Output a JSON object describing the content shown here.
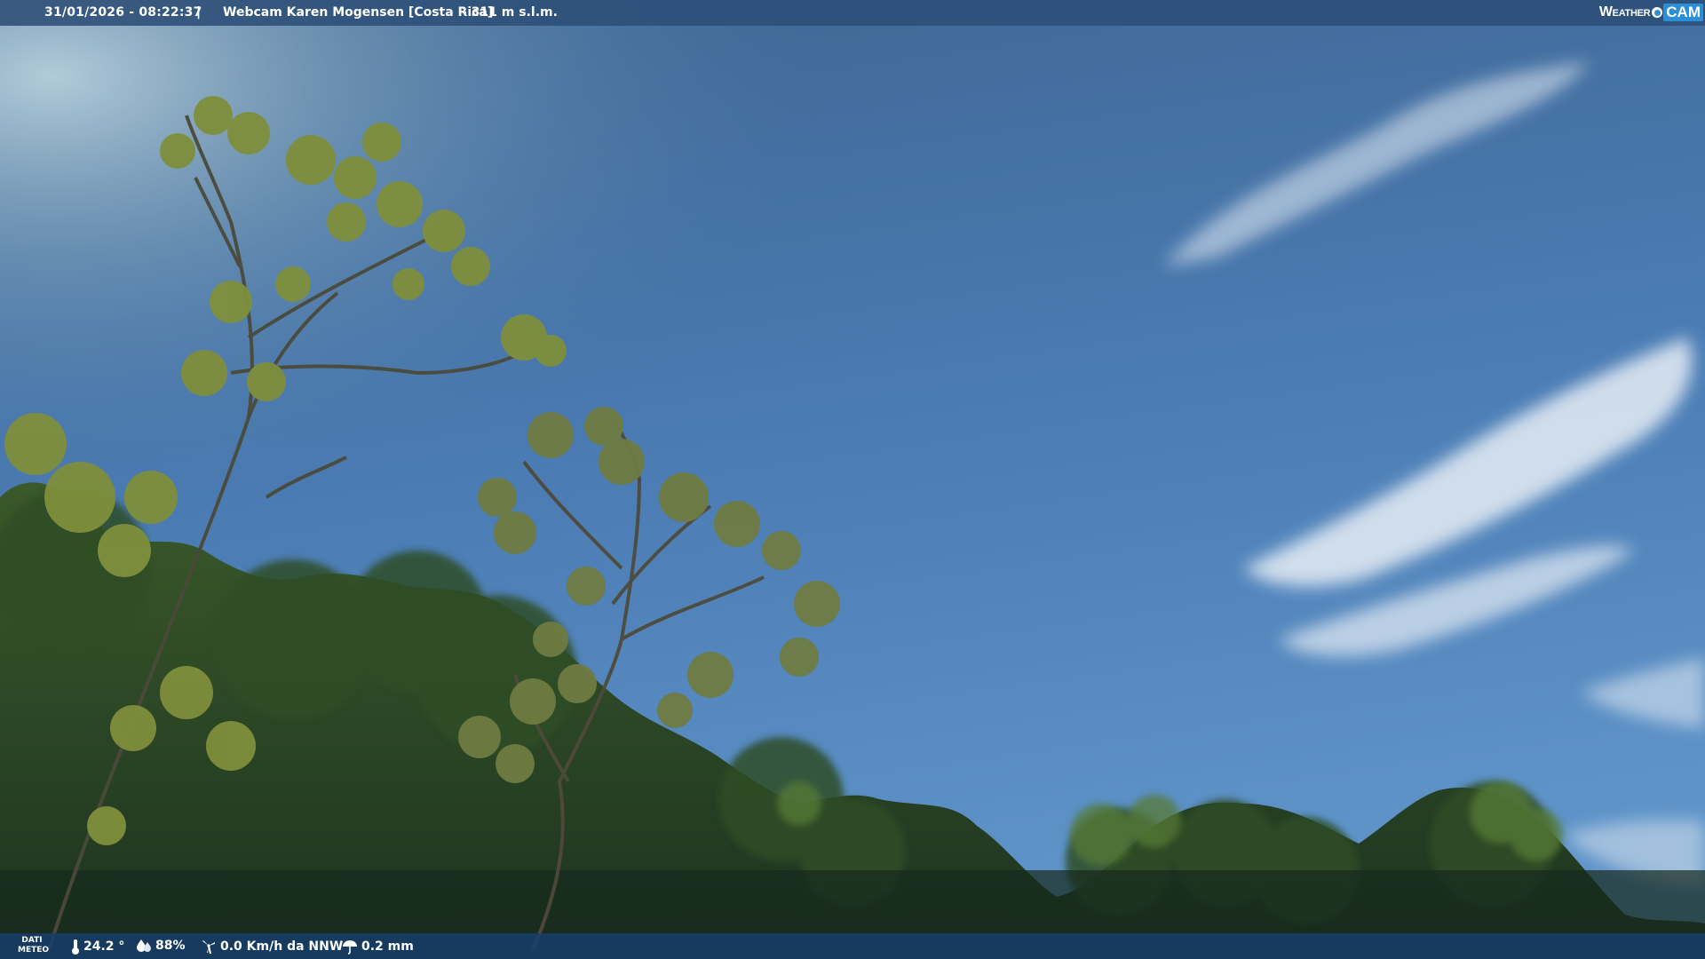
{
  "header": {
    "timestamp": "31/01/2026 - 08:22:37",
    "separator": "|",
    "camera_title": "Webcam Karen Mogensen [Costa Rica]",
    "altitude": "- 311 m s.l.m."
  },
  "logo": {
    "weather_text": "Weather",
    "cam_text": "CAM"
  },
  "weather_bar": {
    "label_line1": "DATI",
    "label_line2": "METEO",
    "temperature": "24.2 °",
    "humidity": "88%",
    "wind": "0.0 Km/h da NNW",
    "rain": "0.2 mm"
  },
  "icons": {
    "temperature": "thermometer-icon",
    "humidity": "humidity-drop-icon",
    "wind": "wind-turbine-icon",
    "rain": "rain-umbrella-icon"
  },
  "colors": {
    "sky_top": "#4a6f98",
    "sky_bottom": "#5b8ec4",
    "bar_top": "#2c4e78",
    "bar_bottom": "#163e6c",
    "logo_accent": "#2b8fd8"
  }
}
